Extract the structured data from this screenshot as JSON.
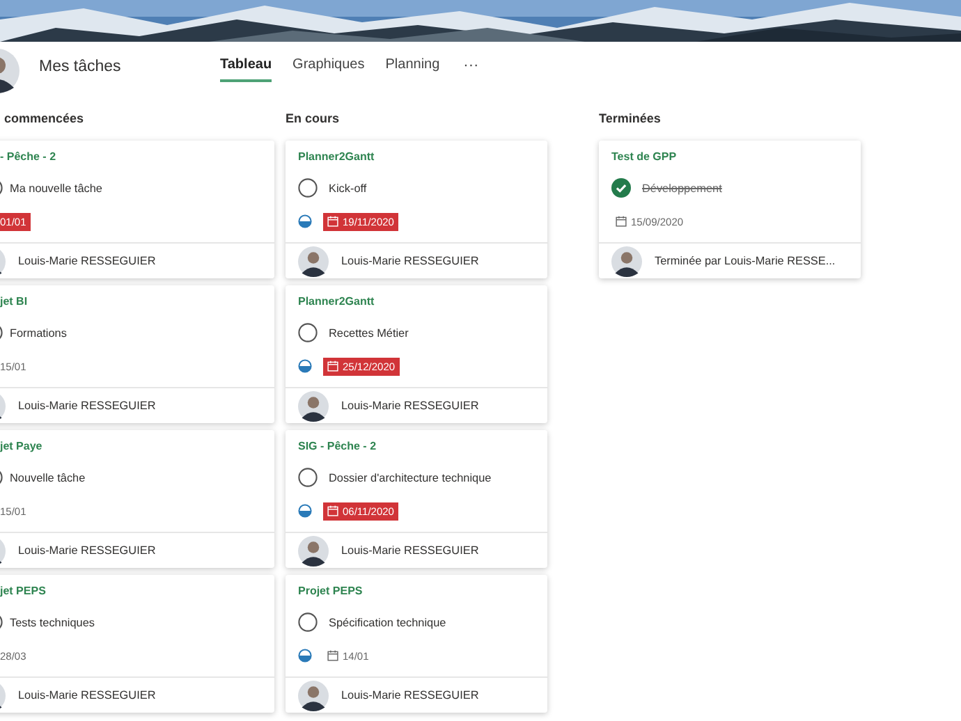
{
  "header": {
    "title": "Mes tâches",
    "tabs": [
      {
        "label": "Tableau",
        "selected": true
      },
      {
        "label": "Graphiques",
        "selected": false
      },
      {
        "label": "Planning",
        "selected": false
      }
    ],
    "more": "···"
  },
  "columns": [
    {
      "title": "commencées",
      "cards": [
        {
          "project": "- Pêche - 2",
          "title": "Ma nouvelle tâche",
          "kind": "not_started",
          "due": "01/01",
          "overdue": true,
          "footer": "Louis-Marie RESSEGUIER"
        },
        {
          "project": "jet BI",
          "title": "Formations",
          "kind": "not_started",
          "due": "15/01",
          "overdue": false,
          "footer": "Louis-Marie RESSEGUIER"
        },
        {
          "project": "jet Paye",
          "title": "Nouvelle tâche",
          "kind": "not_started",
          "due": "15/01",
          "overdue": false,
          "footer": "Louis-Marie RESSEGUIER"
        },
        {
          "project": "jet PEPS",
          "title": "Tests techniques",
          "kind": "not_started",
          "due": "28/03",
          "overdue": false,
          "footer": "Louis-Marie RESSEGUIER"
        }
      ]
    },
    {
      "title": "En cours",
      "cards": [
        {
          "project": "Planner2Gantt",
          "title": "Kick-off",
          "kind": "in_progress",
          "due": "19/11/2020",
          "overdue": true,
          "footer": "Louis-Marie RESSEGUIER"
        },
        {
          "project": "Planner2Gantt",
          "title": "Recettes Métier",
          "kind": "in_progress",
          "due": "25/12/2020",
          "overdue": true,
          "footer": "Louis-Marie RESSEGUIER"
        },
        {
          "project": "SIG - Pêche - 2",
          "title": "Dossier d'architecture technique",
          "kind": "in_progress",
          "due": "06/11/2020",
          "overdue": true,
          "footer": "Louis-Marie RESSEGUIER"
        },
        {
          "project": "Projet PEPS",
          "title": "Spécification technique",
          "kind": "in_progress",
          "due": "14/01",
          "overdue": false,
          "footer": "Louis-Marie RESSEGUIER"
        }
      ]
    },
    {
      "title": "Terminées",
      "cards": [
        {
          "project": "Test de GPP",
          "title": "Développement",
          "kind": "done",
          "due": "15/09/2020",
          "overdue": false,
          "footer": "Terminée par Louis-Marie RESSE..."
        }
      ]
    }
  ]
}
